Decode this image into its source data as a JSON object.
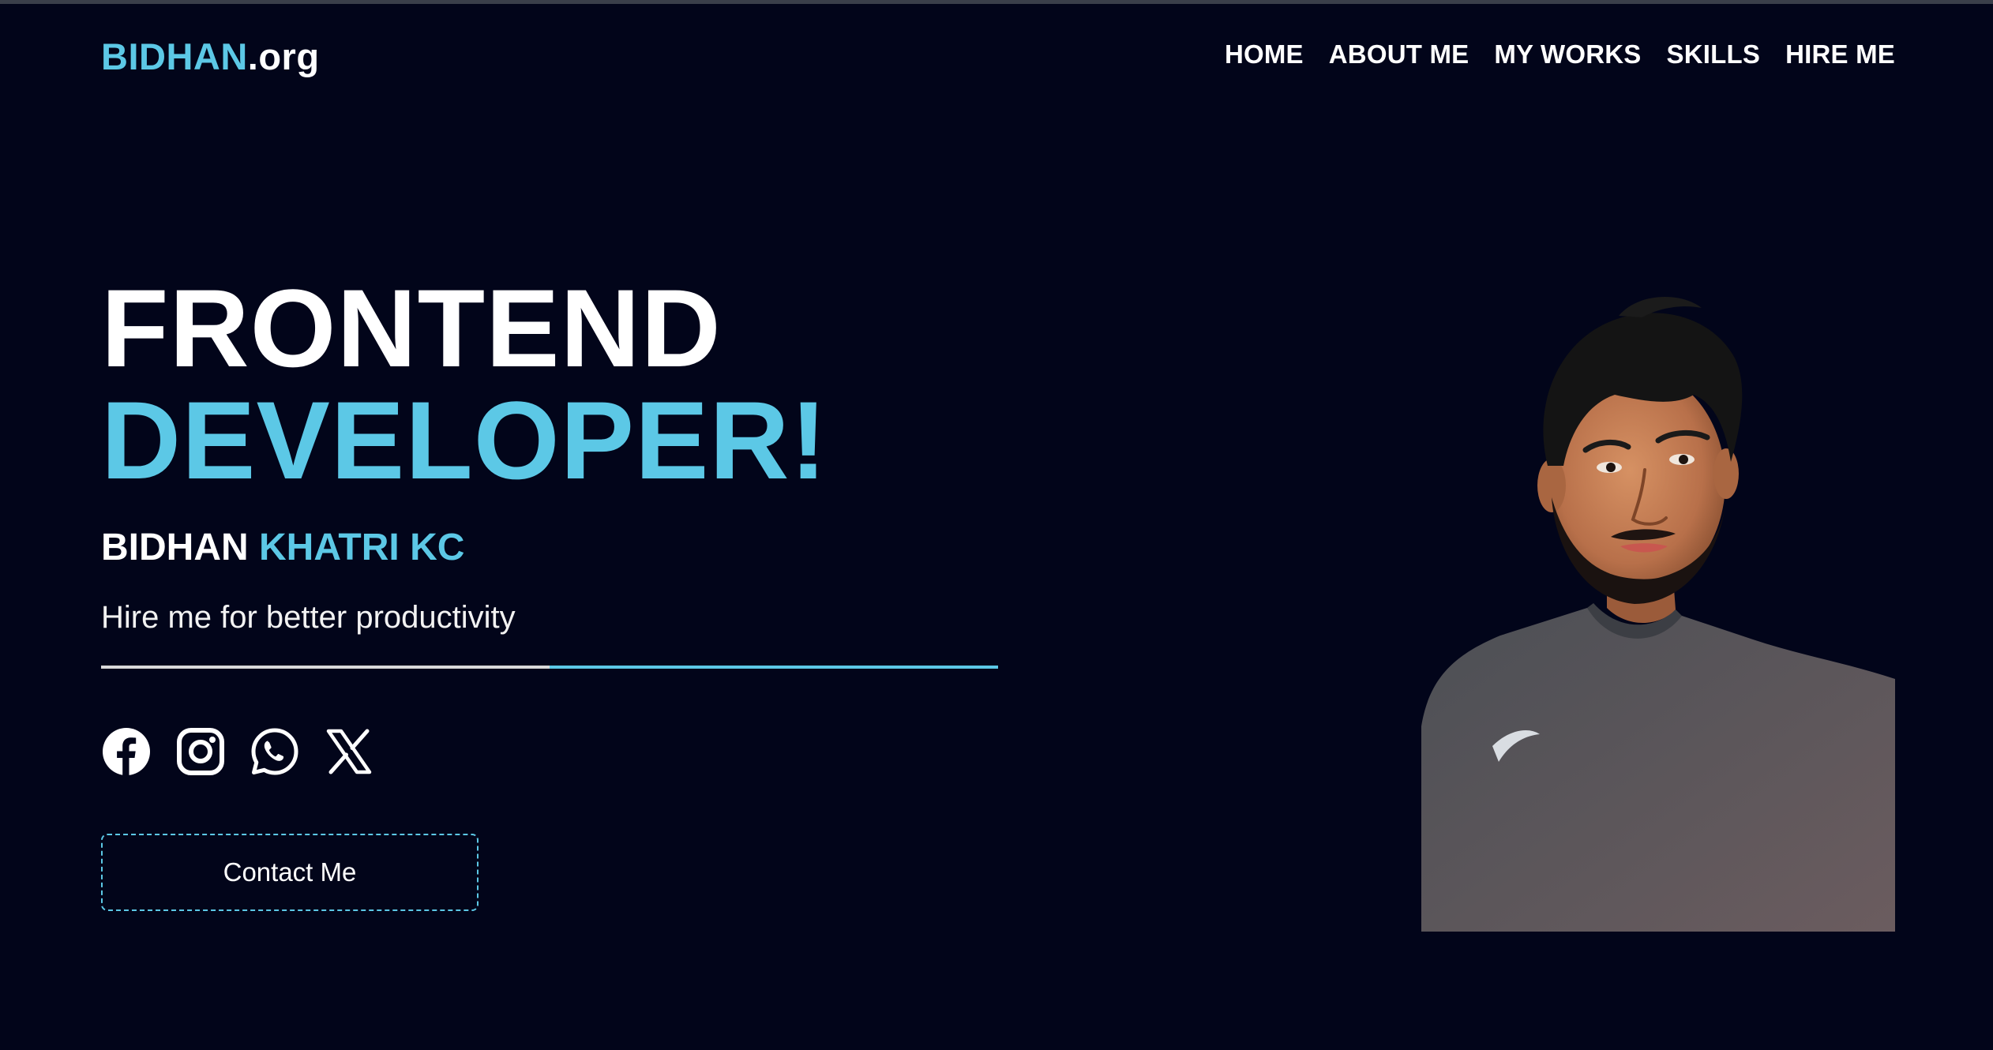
{
  "brand": {
    "logo_accent": "BIDHAN",
    "logo_rest": ".org"
  },
  "nav": {
    "items": [
      {
        "label": "HOME"
      },
      {
        "label": "ABOUT ME"
      },
      {
        "label": "MY WORKS"
      },
      {
        "label": "SKILLS"
      },
      {
        "label": "HIRE ME"
      }
    ]
  },
  "hero": {
    "title_line1": "FRONTEND",
    "title_line2": "DEVELOPER!",
    "name_first": "BIDHAN",
    "name_last": "KHATRI KC",
    "tagline": "Hire me for better productivity",
    "contact_label": "Contact Me"
  },
  "socials": [
    {
      "icon": "facebook-icon"
    },
    {
      "icon": "instagram-icon"
    },
    {
      "icon": "whatsapp-icon"
    },
    {
      "icon": "x-twitter-icon"
    }
  ],
  "colors": {
    "background": "#02051a",
    "accent": "#5cc8e6",
    "text": "#ffffff"
  }
}
